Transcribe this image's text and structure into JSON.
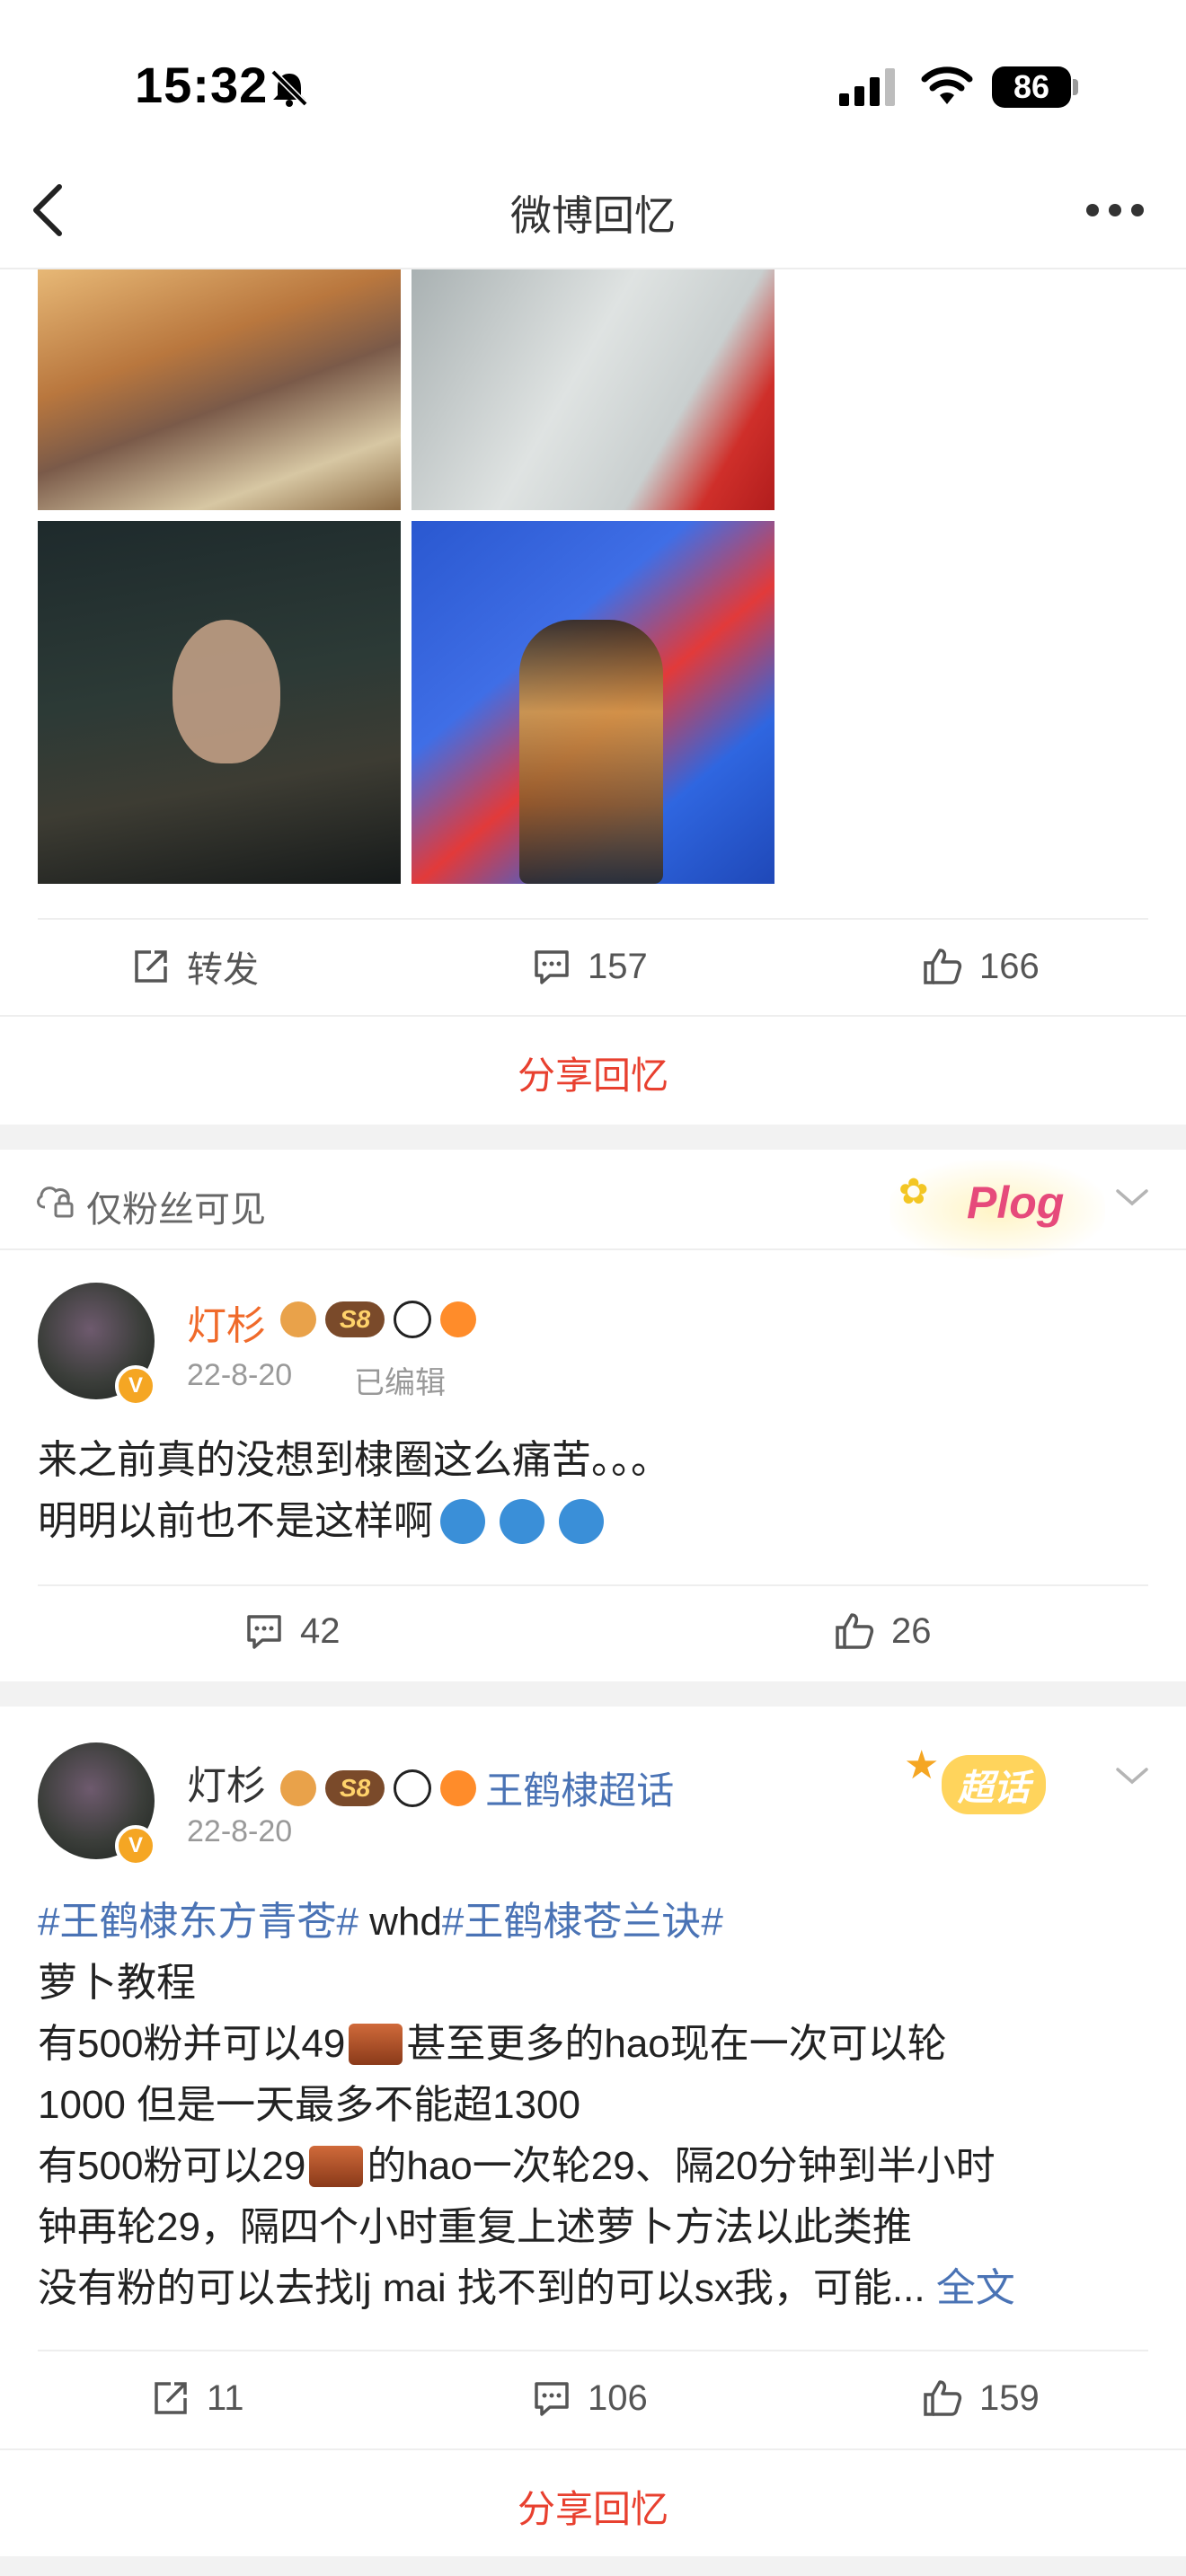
{
  "status_bar": {
    "time": "15:32",
    "battery": "86"
  },
  "nav": {
    "title": "微博回忆"
  },
  "post1": {
    "actions": {
      "repost_label": "转发",
      "comments": "157",
      "likes": "166"
    },
    "share_label": "分享回忆"
  },
  "post2": {
    "visibility": "仅粉丝可见",
    "sticker_text": "Plog",
    "user": {
      "name": "灯杉",
      "level": "S8",
      "verified": "V"
    },
    "date": "22-8-20",
    "edited": "已编辑",
    "lines": [
      "来之前真的没想到棣圈这么痛苦。。。",
      "明明以前也不是这样啊"
    ],
    "actions": {
      "comments": "42",
      "likes": "26"
    }
  },
  "post3": {
    "user": {
      "name": "灯杉",
      "level": "S8",
      "verified": "V"
    },
    "supertopic": "王鹤棣超话",
    "sticker_text": "超话",
    "date": "22-8-20",
    "topic1": "#王鹤棣东方青苍#",
    "mid_text": " whd",
    "topic2": "#王鹤棣苍兰诀#",
    "lines": [
      "萝卜教程",
      "有500粉并可以49",
      " 甚至更多的hao现在一次可以轮",
      "1000 但是一天最多不能超1300",
      "有500粉可以29",
      " 的hao一次轮29、隔20分钟到半小时",
      "钟再轮29，隔四个小时重复上述萝卜方法以此类推",
      "没有粉的可以去找lj mai 找不到的可以sx我，可能..."
    ],
    "read_more": "全文",
    "actions": {
      "reposts": "11",
      "comments": "106",
      "likes": "159"
    },
    "share_label": "分享回忆"
  }
}
